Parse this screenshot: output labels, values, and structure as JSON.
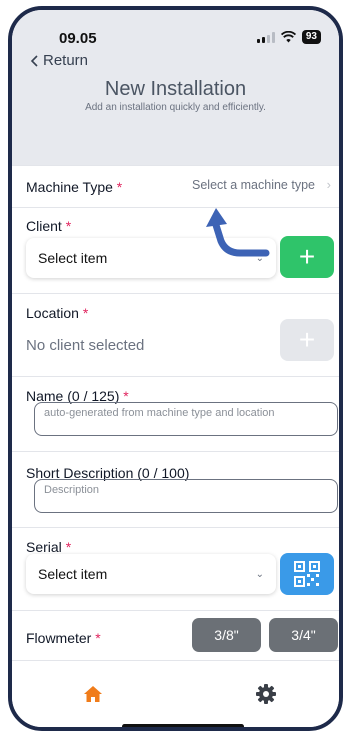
{
  "status_bar": {
    "time": "09.05",
    "battery": "93"
  },
  "nav": {
    "return_label": "Return"
  },
  "header": {
    "title": "New Installation",
    "subtitle": "Add an installation quickly and efficiently."
  },
  "form": {
    "machine_type": {
      "label": "Machine Type",
      "required_mark": "*",
      "value": "Select a machine type",
      "chevron": "›"
    },
    "client": {
      "label": "Client",
      "required_mark": "*",
      "select_value": "Select item",
      "add_label": "+"
    },
    "location": {
      "label": "Location",
      "required_mark": "*",
      "value": "No client selected",
      "add_label": "+"
    },
    "name": {
      "label": "Name (0 / 125)",
      "required_mark": "*",
      "placeholder": "auto-generated from machine type and location"
    },
    "short_description": {
      "label": "Short Description (0 / 100)",
      "placeholder": "Description"
    },
    "serial": {
      "label": "Serial",
      "required_mark": "*",
      "select_value": "Select item"
    },
    "flowmeter": {
      "label": "Flowmeter",
      "required_mark": "*",
      "options": [
        "3/8\"",
        "3/4\""
      ]
    }
  },
  "tabbar": {
    "items": [
      {
        "icon": "home-icon"
      },
      {
        "icon": "gear-icon"
      }
    ]
  },
  "colors": {
    "accent_green": "#2fc46a",
    "accent_blue": "#3a9ae8",
    "required_red": "#e0245e",
    "tab_active": "#f07c1a",
    "frame": "#1e2a4a",
    "annotation_arrow": "#3d63b5"
  }
}
